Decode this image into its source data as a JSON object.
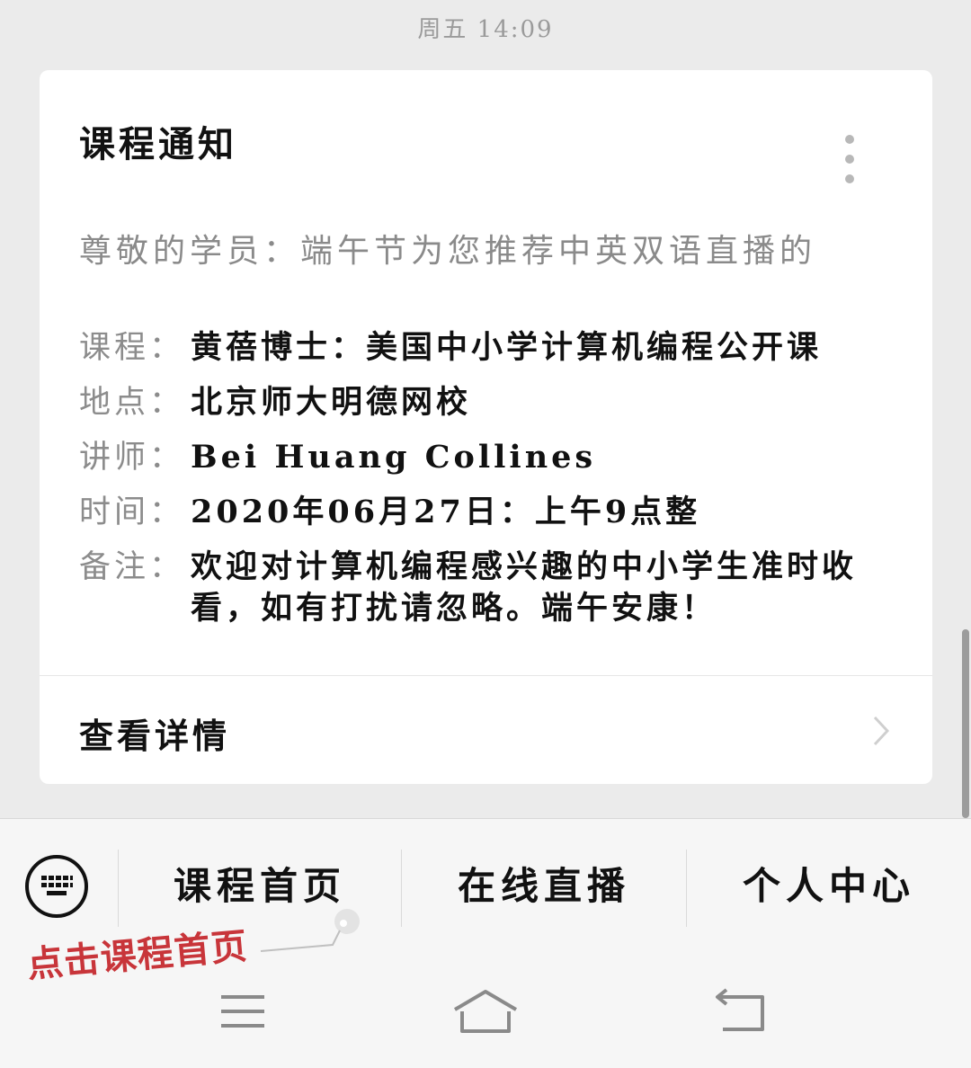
{
  "status": {
    "timestamp": "周五 14:09"
  },
  "card": {
    "title": "课程通知",
    "greeting": "尊敬的学员：端午节为您推荐中英双语直播的",
    "fields": [
      {
        "label": "课程：",
        "value": "黄蓓博士：美国中小学计算机编程公开课"
      },
      {
        "label": "地点：",
        "value": "北京师大明德网校"
      },
      {
        "label": "讲师：",
        "value": "Bei Huang Collines"
      },
      {
        "label": "时间：",
        "value": "2020年06月27日：上午9点整"
      },
      {
        "label": "备注：",
        "value": "欢迎对计算机编程感兴趣的中小学生准时收看，如有打扰请忽略。端午安康！"
      }
    ],
    "footer_label": "查看详情"
  },
  "menu": {
    "items": [
      {
        "label": "课程首页"
      },
      {
        "label": "在线直播"
      },
      {
        "label": "个人中心"
      }
    ]
  },
  "annotation": {
    "text": "点击课程首页"
  },
  "colors": {
    "background": "#ebebeb",
    "card": "#ffffff",
    "annotation": "#c8353a"
  },
  "icons": {
    "keyboard_toggle": "keyboard-icon",
    "more": "more-vertical-icon",
    "chevron": "chevron-right-icon",
    "nav_menu": "menu-icon",
    "nav_home": "home-icon",
    "nav_back": "back-icon"
  }
}
